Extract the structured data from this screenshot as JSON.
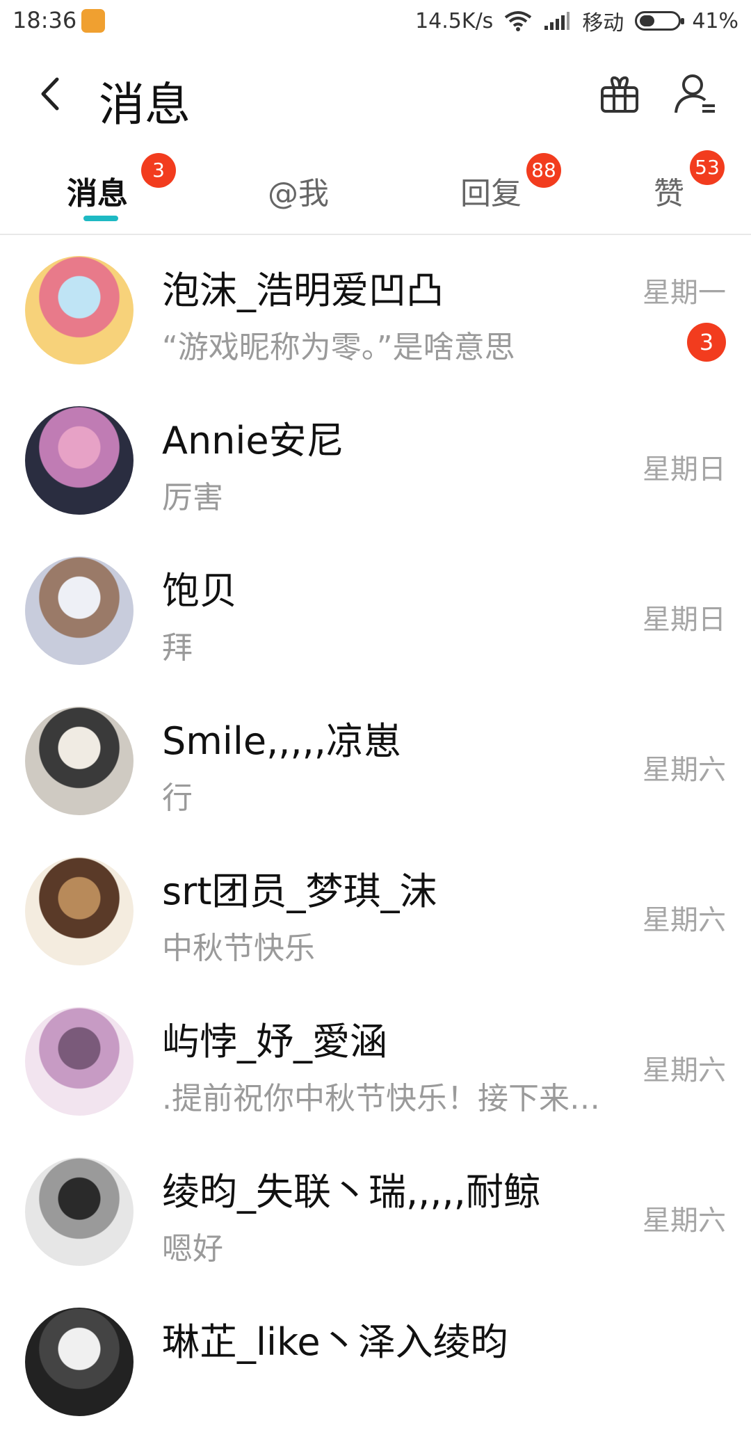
{
  "status_bar": {
    "time": "18:36",
    "net_speed": "14.5K/s",
    "carrier": "移动",
    "battery": "41%",
    "battery_level": 0.41
  },
  "header": {
    "title": "消息"
  },
  "tabs": [
    {
      "label": "消息",
      "badge": "3",
      "active": true
    },
    {
      "label": "@我",
      "badge": ""
    },
    {
      "label": "回复",
      "badge": "88"
    },
    {
      "label": "赞",
      "badge": "53"
    }
  ],
  "conversations": [
    {
      "name": "泡沫_浩明爱凹凸",
      "preview": "“游戏昵称为零。”是啥意思",
      "time": "星期一",
      "unread": "3",
      "avatar_colors": [
        "#f7d27a",
        "#e87a8a",
        "#bfe4f5"
      ]
    },
    {
      "name": "Annie安尼",
      "preview": "厉害",
      "time": "星期日",
      "unread": "",
      "avatar_colors": [
        "#2a2d40",
        "#c07cb4",
        "#e7a2c6"
      ]
    },
    {
      "name": "饱贝",
      "preview": "拜",
      "time": "星期日",
      "unread": "",
      "avatar_colors": [
        "#c8ccdc",
        "#9a7a68",
        "#eef0f6"
      ]
    },
    {
      "name": "Smile,,,,,凉崽",
      "preview": "行",
      "time": "星期六",
      "unread": "",
      "avatar_colors": [
        "#cfcac2",
        "#3a3a3a",
        "#f0ebe3"
      ]
    },
    {
      "name": "srt团员_梦琪_沫",
      "preview": "中秋节快乐",
      "time": "星期六",
      "unread": "",
      "avatar_colors": [
        "#f4ecdf",
        "#5a3a28",
        "#b88a5a"
      ]
    },
    {
      "name": "屿悖_妤_愛涵",
      "preview": ".提前祝你中秋节快乐！接下来的日子",
      "time": "星期六",
      "unread": "",
      "avatar_colors": [
        "#f2e4ef",
        "#c79bc4",
        "#7a5a7a"
      ]
    },
    {
      "name": "绫昀_失联丶瑞,,,,,耐鲸",
      "preview": "嗯好",
      "time": "星期六",
      "unread": "",
      "avatar_colors": [
        "#e6e6e6",
        "#9a9a9a",
        "#2a2a2a"
      ]
    },
    {
      "name": "琳芷_like丶泽入绫昀",
      "preview": "",
      "time": "",
      "unread": "",
      "avatar_colors": [
        "#222222",
        "#444444",
        "#f0f0f0"
      ]
    }
  ]
}
